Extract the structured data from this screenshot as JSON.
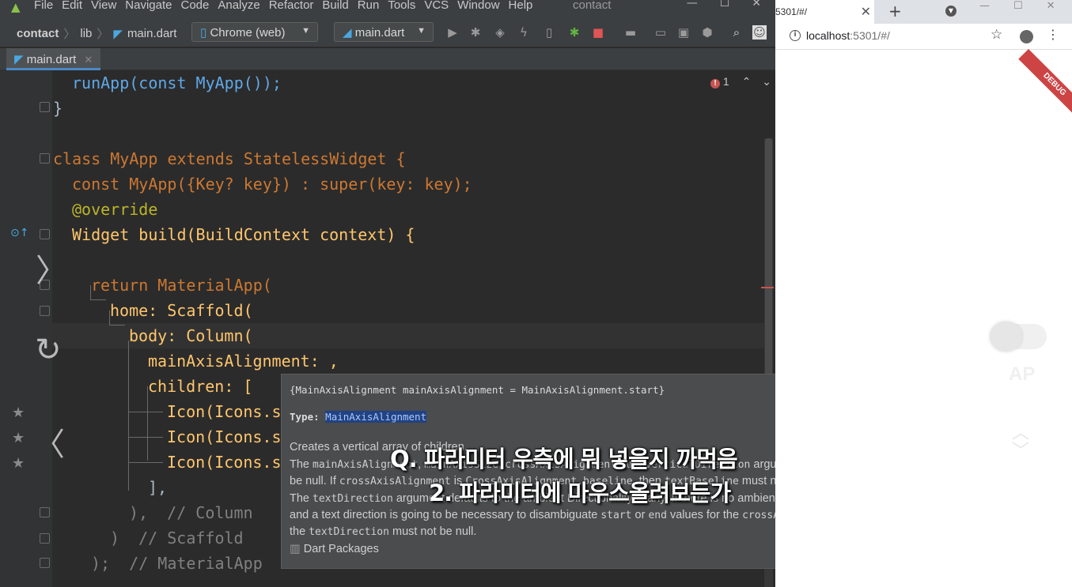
{
  "ide": {
    "menu": [
      "File",
      "Edit",
      "View",
      "Navigate",
      "Code",
      "Analyze",
      "Refactor",
      "Build",
      "Run",
      "Tools",
      "VCS",
      "Window",
      "Help"
    ],
    "project_title": "contact",
    "breadcrumb": [
      "contact",
      "lib",
      "main.dart"
    ],
    "device_combo": "Chrome (web)",
    "config_combo": "main.dart",
    "tab_label": "main.dart",
    "error_count": "1",
    "code_lines": [
      "runApp(const MyApp());",
      "}",
      "class MyApp extends StatelessWidget {",
      "const MyApp({Key? key}) : super(key: key);",
      "@override",
      "Widget build(BuildContext context) {",
      "return MaterialApp(",
      "home: Scaffold(",
      "body: Column(",
      "mainAxisAlignment: ,",
      "children: [",
      "Icon(Icons.s",
      "Icon(Icons.s",
      "Icon(Icons.s",
      "],",
      "),  // Column",
      ")  // Scaffold",
      ");  // MaterialApp"
    ]
  },
  "doc_popup": {
    "signature": "{MainAxisAlignment mainAxisAlignment = MainAxisAlignment.start}",
    "type_label": "Type:",
    "type_value": "MainAxisAlignment",
    "para1": "Creates a vertical array of children.",
    "para2_prefix": "The",
    "para2_code1": "mainAxisAlignment",
    "para2_code2": "mainAxisSize",
    "para2_code3": "crossAxisAlignment",
    "para2_mid": "and",
    "para2_code4": "verticalDirection",
    "para2_suffix": "arguments must not be null. If",
    "para2_code5": "crossAxisAlignment",
    "para2_is": "is",
    "para2_code6": "CrossAxisAlignment.baseline",
    "para2_then": ", then",
    "para2_code7": "textBaseline",
    "para2_end": "must not be null.",
    "para3_prefix": "The",
    "para3_code1": "textDirection",
    "para3_text": "argument defaults to the ambient Directionality, if any. If there is no ambient directionality, and a text direction is going to be necessary to disambiguate",
    "para3_code2": "start",
    "para3_or": "or",
    "para3_code3": "end",
    "para3_text2": "values for the",
    "para3_code4": "crossAxisAlignment",
    "para3_the": ", the",
    "para3_code5": "textDirection",
    "para3_end": "must not be null.",
    "package": "Dart Packages"
  },
  "subtitles": {
    "line1": "Q. 파라미터 우측에 뭐 넣을지 까먹음",
    "line2": "2. 파라미터에 마우스올려보든가"
  },
  "browser": {
    "tab_title": "5301/#/",
    "url_host": "localhost",
    "url_rest": ":5301/#/",
    "debug_banner": "DEBUG",
    "app_text": "AP"
  }
}
